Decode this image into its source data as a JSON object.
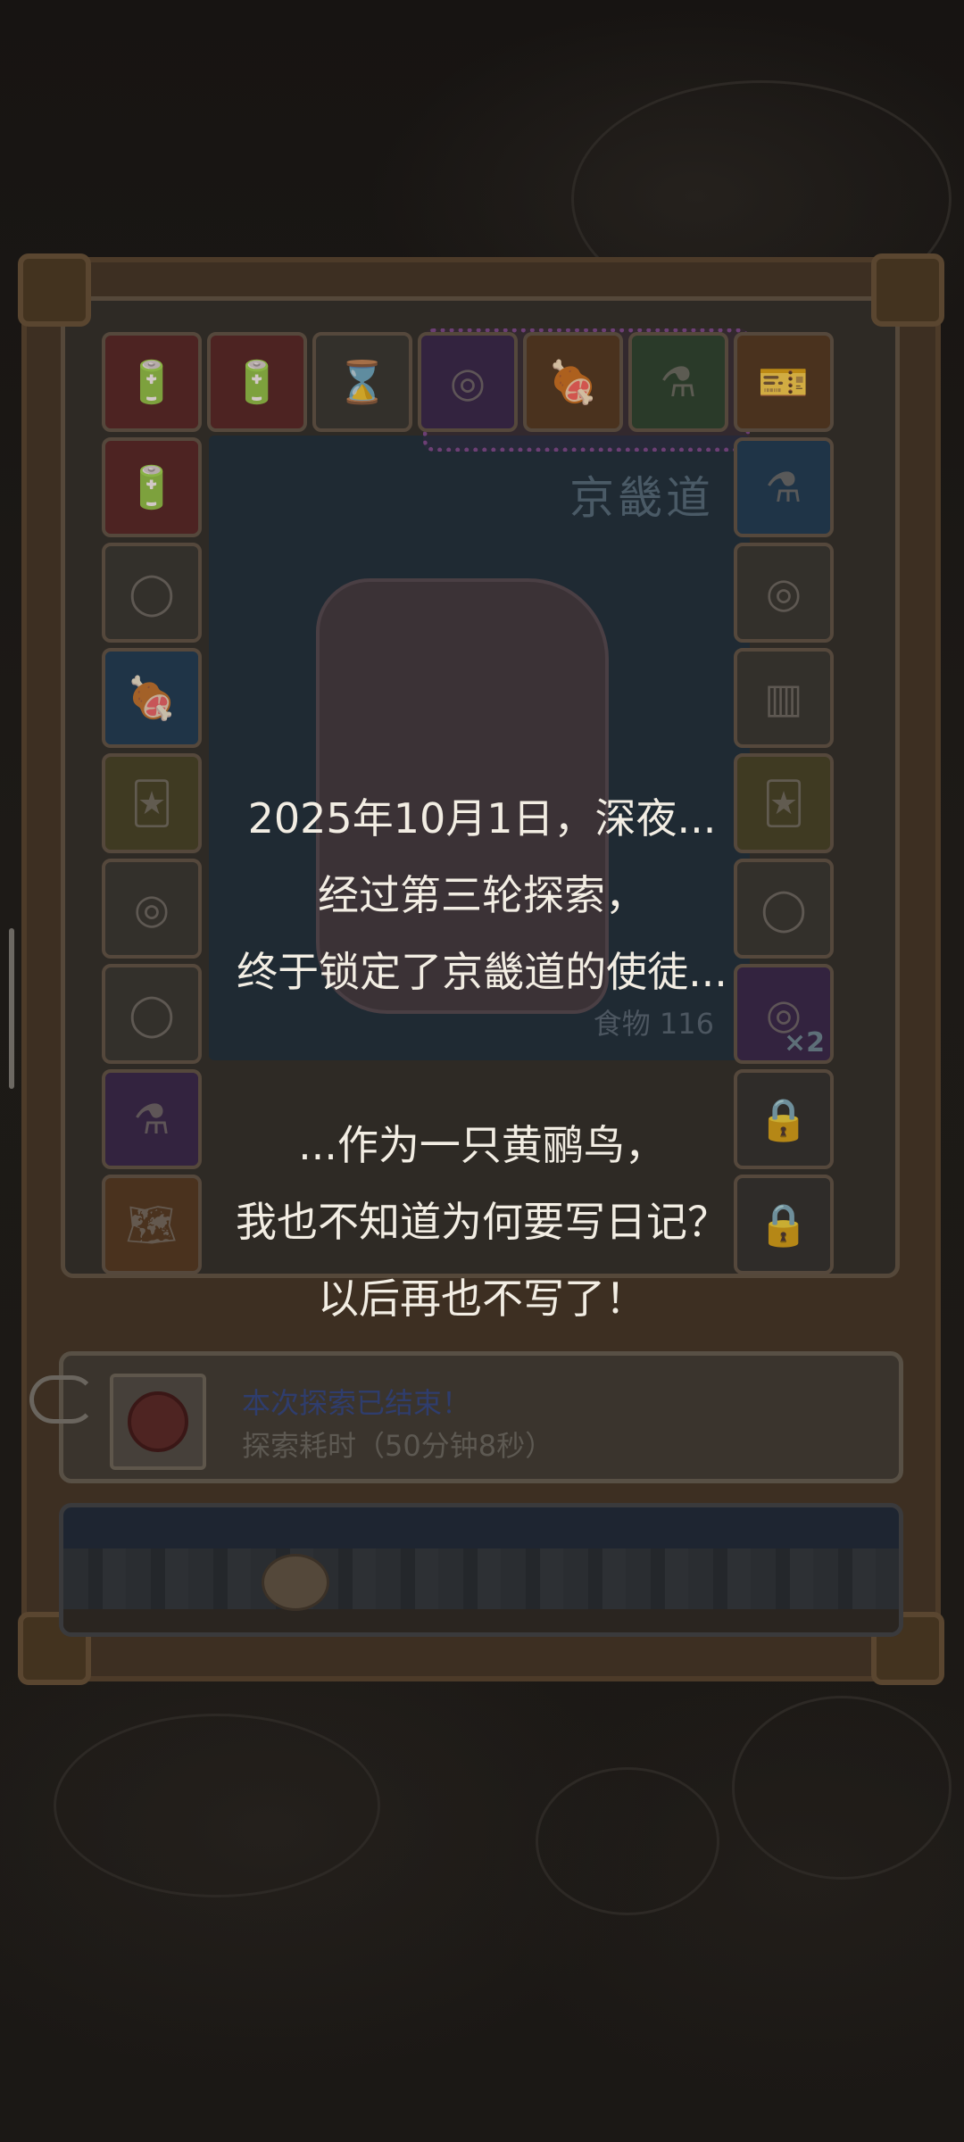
{
  "board": {
    "region_name": "京畿道",
    "food_label": "食物",
    "food_value": "116",
    "multiplier_badge": "×2",
    "tiles": [
      {
        "icon": "battery-red-icon",
        "glyph": "🔋",
        "tone": "red"
      },
      {
        "icon": "battery-red-icon",
        "glyph": "🔋",
        "tone": "red"
      },
      {
        "icon": "hourglass-icon",
        "glyph": "⌛",
        "tone": "gray"
      },
      {
        "icon": "spiral-orb-icon",
        "glyph": "◎",
        "tone": "purple"
      },
      {
        "icon": "meat-icon",
        "glyph": "🍖",
        "tone": "orange"
      },
      {
        "icon": "potion-bottle-icon",
        "glyph": "⚗",
        "tone": "green"
      },
      {
        "icon": "ticket-icon",
        "glyph": "🎫",
        "tone": "orange"
      },
      {
        "icon": "battery-red-icon",
        "glyph": "🔋",
        "tone": "red"
      },
      {
        "icon": "potion-bottle-icon",
        "glyph": "⚗",
        "tone": "blue"
      },
      {
        "icon": "ghost-blob-icon",
        "glyph": "◯",
        "tone": "gray"
      },
      {
        "icon": "spiral-orb-icon",
        "glyph": "◎",
        "tone": "gray"
      },
      {
        "icon": "meat-icon",
        "glyph": "🍖",
        "tone": "blue"
      },
      {
        "icon": "pillar-gift-icon",
        "glyph": "▥",
        "tone": "gray"
      },
      {
        "icon": "card-icon",
        "glyph": "🃏",
        "tone": "yellow"
      },
      {
        "icon": "card-icon",
        "glyph": "🃏",
        "tone": "yellow"
      },
      {
        "icon": "spiral-orb-icon",
        "glyph": "◎",
        "tone": "gray"
      },
      {
        "icon": "ghost-blob-icon",
        "glyph": "◯",
        "tone": "gray"
      },
      {
        "icon": "ghost-blob-icon",
        "glyph": "◯",
        "tone": "gray"
      },
      {
        "icon": "spiral-orb-icon",
        "glyph": "◎",
        "tone": "purple"
      },
      {
        "icon": "potion-bottle-icon",
        "glyph": "⚗",
        "tone": "purple"
      },
      {
        "icon": "lock-icon",
        "glyph": "🔒",
        "tone": "locked"
      },
      {
        "icon": "scroll-map-icon",
        "glyph": "🗺",
        "tone": "orange"
      },
      {
        "icon": "lock-icon",
        "glyph": "🔒",
        "tone": "locked"
      }
    ]
  },
  "story": {
    "lines": [
      "2025年10月1日，深夜...",
      "经过第三轮探索，",
      "终于锁定了京畿道的使徒...",
      "...作为一只黄鹂鸟，",
      "我也不知道为何要写日记？",
      "以后再也不写了！"
    ]
  },
  "info": {
    "title": "本次探索已结束！",
    "subtitle": "探索耗时（50分钟8秒）"
  },
  "colors": {
    "story_text": "#f2ede3",
    "info_title": "#2f3d6d",
    "frame": "#4d3b29"
  }
}
